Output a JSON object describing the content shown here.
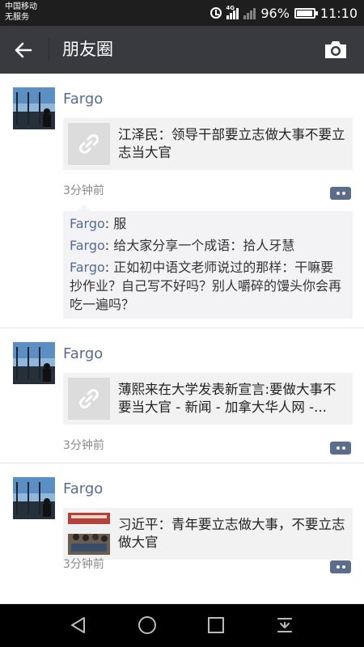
{
  "status_bar": {
    "carrier_line1": "中国移动",
    "carrier_line2": "无服务",
    "network": "4G",
    "battery_percent": "96%",
    "battery_level": 0.96,
    "time": "11:10"
  },
  "nav": {
    "title": "朋友圈",
    "back_icon": "arrow-left-icon",
    "camera_icon": "camera-icon"
  },
  "posts": [
    {
      "author": "Fargo",
      "link_title": "江泽民：领导干部要立志做大事不要立志当大官",
      "link_thumb": "link-icon",
      "time": "3分钟前",
      "comments": [
        {
          "name": "Fargo",
          "text": ": 服"
        },
        {
          "name": "Fargo",
          "text": ": 给大家分享一个成语：拾人牙慧"
        },
        {
          "name": "Fargo",
          "text": ": 正如初中语文老师说过的那样：干嘛要抄作业？自己写不好吗？别人嚼碎的馒头你会再吃一遍吗？"
        }
      ]
    },
    {
      "author": "Fargo",
      "link_title": "薄熙来在大学发表新宣言:要做大事不要当大官 - 新闻 - 加拿大华人网 -...",
      "link_thumb": "link-icon",
      "time": "3分钟前"
    },
    {
      "author": "Fargo",
      "link_title": "习近平：青年要立志做大事，不要立志做大官",
      "link_thumb": "classroom-photo",
      "time": "3分钟前"
    }
  ],
  "system_nav": {
    "back": "triangle-back-icon",
    "home": "circle-home-icon",
    "recent": "square-recent-icon",
    "notifications": "pull-down-icon"
  },
  "colors": {
    "nav_bg": "#393a3f",
    "author_blue": "#576b95",
    "status_bg": "#1e1e1e"
  }
}
